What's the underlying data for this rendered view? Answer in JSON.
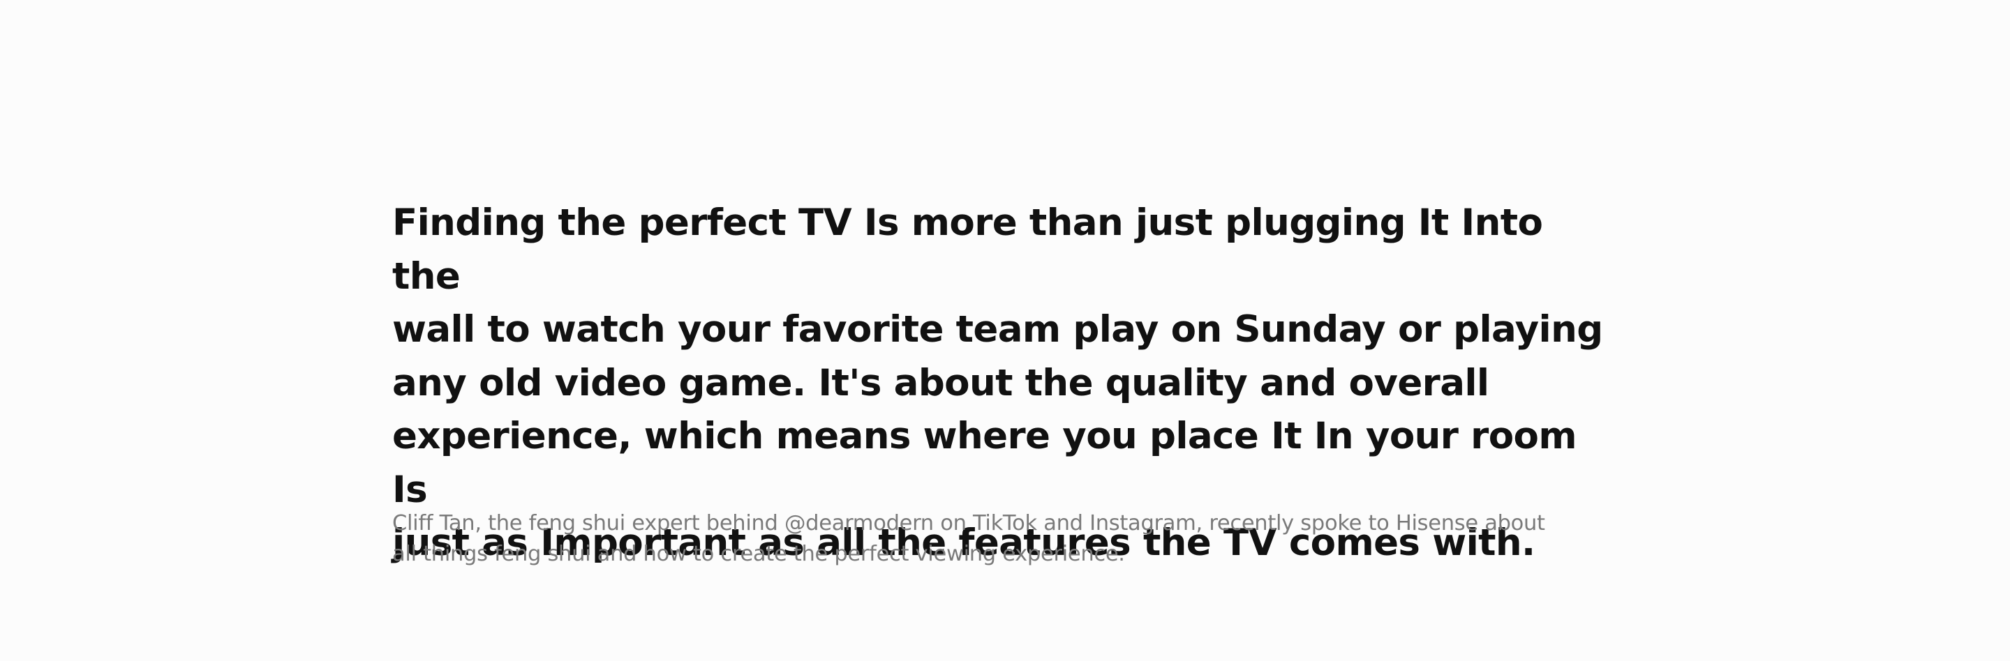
{
  "quote": {
    "headline": "Finding the perfect TV Is more than just plugging It Into the\nwall to watch your favorite team play on Sunday or playing\nany old video game.  It's about the quality and overall\nexperience, which means where you place It In your room Is\njust as Important as all the features the TV comes with.",
    "subtext": "Cliff Tan, the feng shui expert behind @dearmodern on TikTok and Instagram, recently spoke to Hisense about\nall things feng shui and how to create the perfect viewing experience."
  },
  "colors": {
    "background": "#fcfcfc",
    "headline": "#111111",
    "subtext": "#7a7a7a"
  }
}
